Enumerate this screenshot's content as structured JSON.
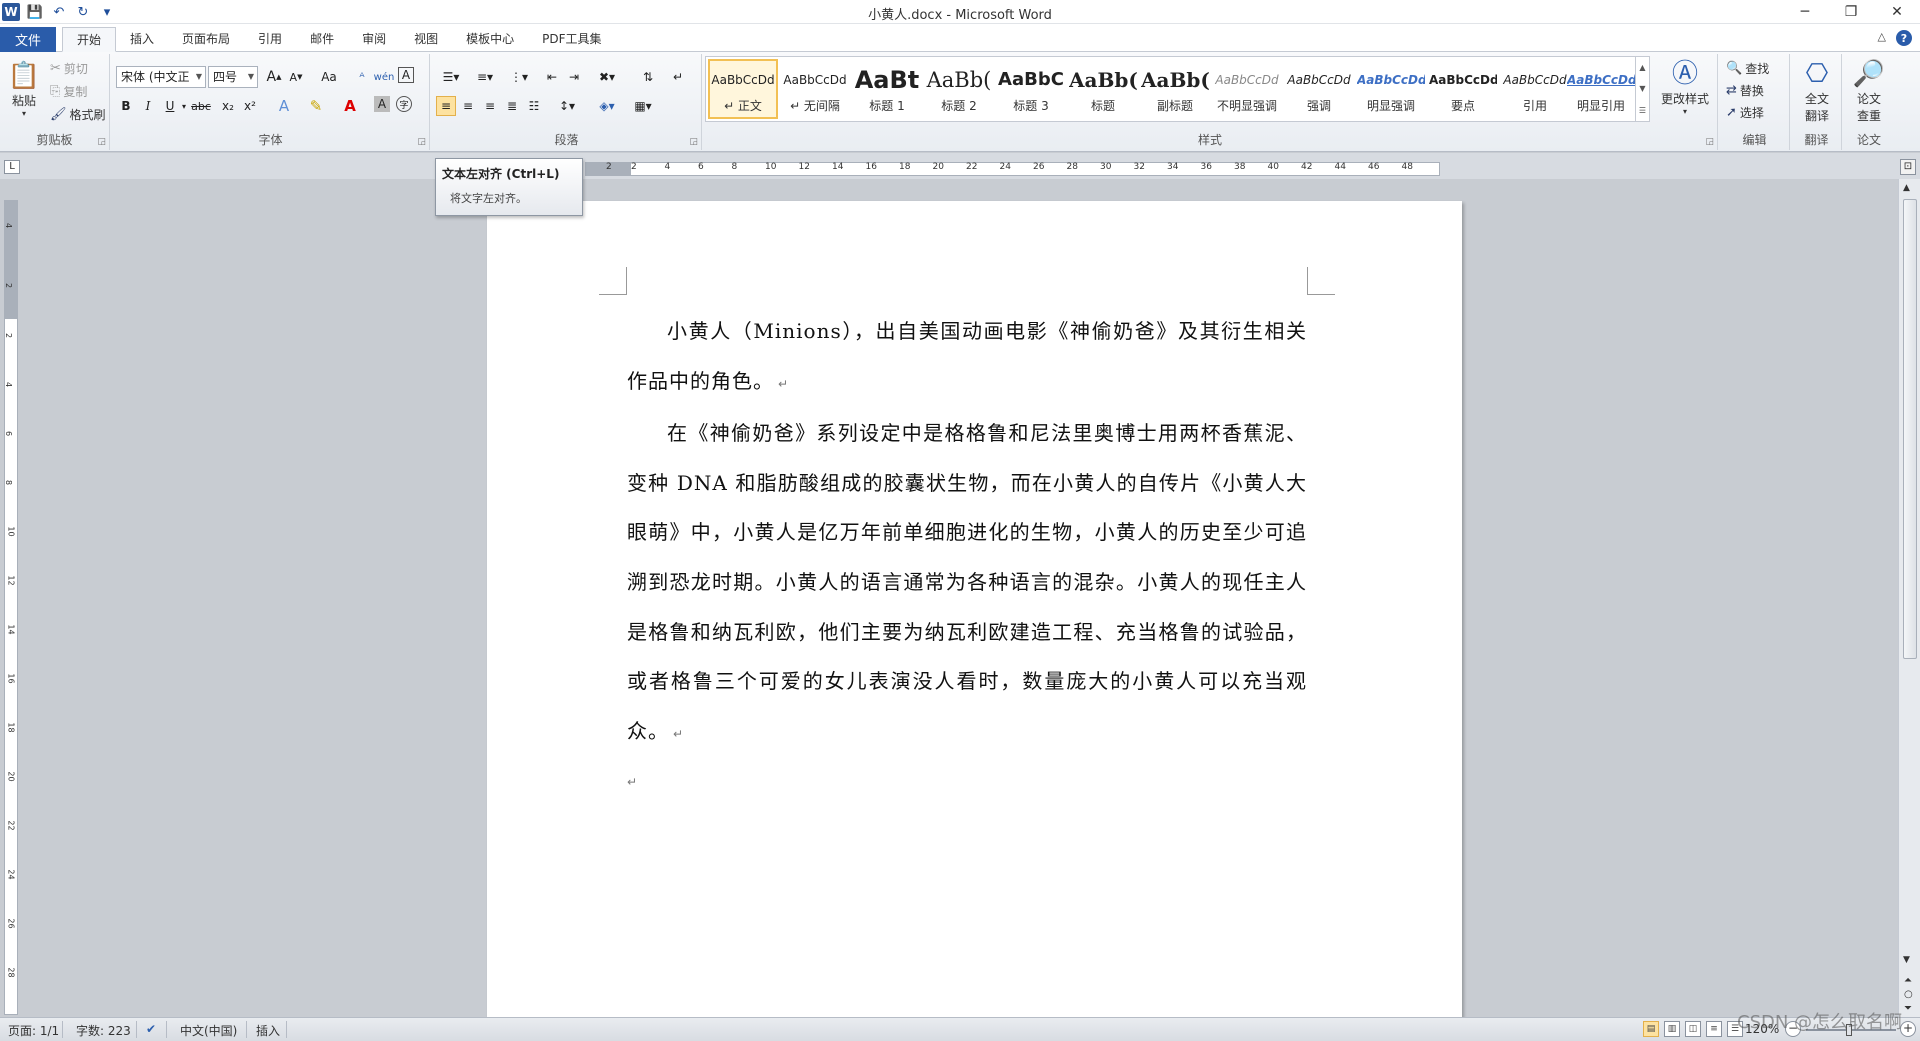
{
  "window": {
    "title": "小黄人.docx - Microsoft Word",
    "app_icon": "W",
    "minimize": "─",
    "restore": "❐",
    "close": "✕"
  },
  "qat": {
    "save_icon": "💾",
    "undo_icon": "↶",
    "redo_icon": "↻",
    "customize_icon": "▾"
  },
  "tabs": {
    "file": "文件",
    "items": [
      "开始",
      "插入",
      "页面布局",
      "引用",
      "邮件",
      "审阅",
      "视图",
      "模板中心",
      "PDF工具集"
    ],
    "active_index": 0,
    "help": "?",
    "minimize_ribbon": "△"
  },
  "ribbon": {
    "clipboard": {
      "label": "剪贴板",
      "paste": "粘贴",
      "paste_sub": "▾",
      "cut": "剪切",
      "copy": "复制",
      "format_painter": "格式刷"
    },
    "font": {
      "label": "字体",
      "font_name": "宋体 (中文正",
      "font_size": "四号",
      "grow": "A",
      "shrink": "A",
      "change_case": "Aa",
      "bold": "B",
      "italic": "I",
      "underline": "U",
      "strike": "abc",
      "subscript": "x₂",
      "superscript": "x²"
    },
    "paragraph": {
      "label": "段落"
    },
    "styles": {
      "label": "样式",
      "items": [
        {
          "sample": "AaBbCcDd",
          "name": "↵ 正文"
        },
        {
          "sample": "AaBbCcDd",
          "name": "↵ 无间隔"
        },
        {
          "sample": "AaBt",
          "name": "标题 1"
        },
        {
          "sample": "AaBb(",
          "name": "标题 2"
        },
        {
          "sample": "AaBbC",
          "name": "标题 3"
        },
        {
          "sample": "AaBb(",
          "name": "标题"
        },
        {
          "sample": "AaBb(",
          "name": "副标题"
        },
        {
          "sample": "AaBbCcDd",
          "name": "不明显强调"
        },
        {
          "sample": "AaBbCcDd",
          "name": "强调"
        },
        {
          "sample": "AaBbCcDd",
          "name": "明显强调"
        },
        {
          "sample": "AaBbCcDd",
          "name": "要点"
        },
        {
          "sample": "AaBbCcDd",
          "name": "引用"
        },
        {
          "sample": "AaBbCcDd",
          "name": "明显引用"
        }
      ],
      "change_styles": "更改样式"
    },
    "editing": {
      "label": "编辑",
      "find": "查找",
      "replace": "替换",
      "select": "选择"
    },
    "translate": {
      "label": "翻译",
      "full": "全文",
      "full2": "翻译"
    },
    "paper": {
      "label": "论文",
      "check": "论文",
      "check2": "查重"
    }
  },
  "tooltip": {
    "title": "文本左对齐 (Ctrl+L)",
    "desc": "将文字左对齐。"
  },
  "ruler": {
    "corner": "L",
    "h_numbers": [
      "2",
      "2",
      "4",
      "6",
      "8",
      "10",
      "12",
      "14",
      "16",
      "18",
      "20",
      "22",
      "24",
      "26",
      "28",
      "30",
      "32",
      "34",
      "36",
      "38",
      "40",
      "42",
      "44",
      "46",
      "48"
    ],
    "v_numbers": [
      "4",
      "2",
      "2",
      "4",
      "6",
      "8",
      "10",
      "12",
      "14",
      "16",
      "18",
      "20",
      "22",
      "24",
      "26",
      "28"
    ]
  },
  "document": {
    "paragraphs": [
      "小黄人（Minions），出自美国动画电影《神偷奶爸》及其衍生相关作品中的角色。",
      "在《神偷奶爸》系列设定中是格格鲁和尼法里奥博士用两杯香蕉泥、变种 DNA 和脂肪酸组成的胶囊状生物，而在小黄人的自传片《小黄人大眼萌》中，小黄人是亿万年前单细胞进化的生物，小黄人的历史至少可追溯到恐龙时期。小黄人的语言通常为各种语言的混杂。小黄人的现任主人是格鲁和纳瓦利欧，他们主要为纳瓦利欧建造工程、充当格鲁的试验品，或者格鲁三个可爱的女儿表演没人看时，数量庞大的小黄人可以充当观众。"
    ],
    "para_mark": "↵"
  },
  "statusbar": {
    "page": "页面: 1/1",
    "words": "字数: 223",
    "language": "中文(中国)",
    "mode": "插入",
    "zoom": "120%",
    "minus": "−",
    "plus": "+"
  },
  "watermark": "CSDN @怎么取名啊"
}
